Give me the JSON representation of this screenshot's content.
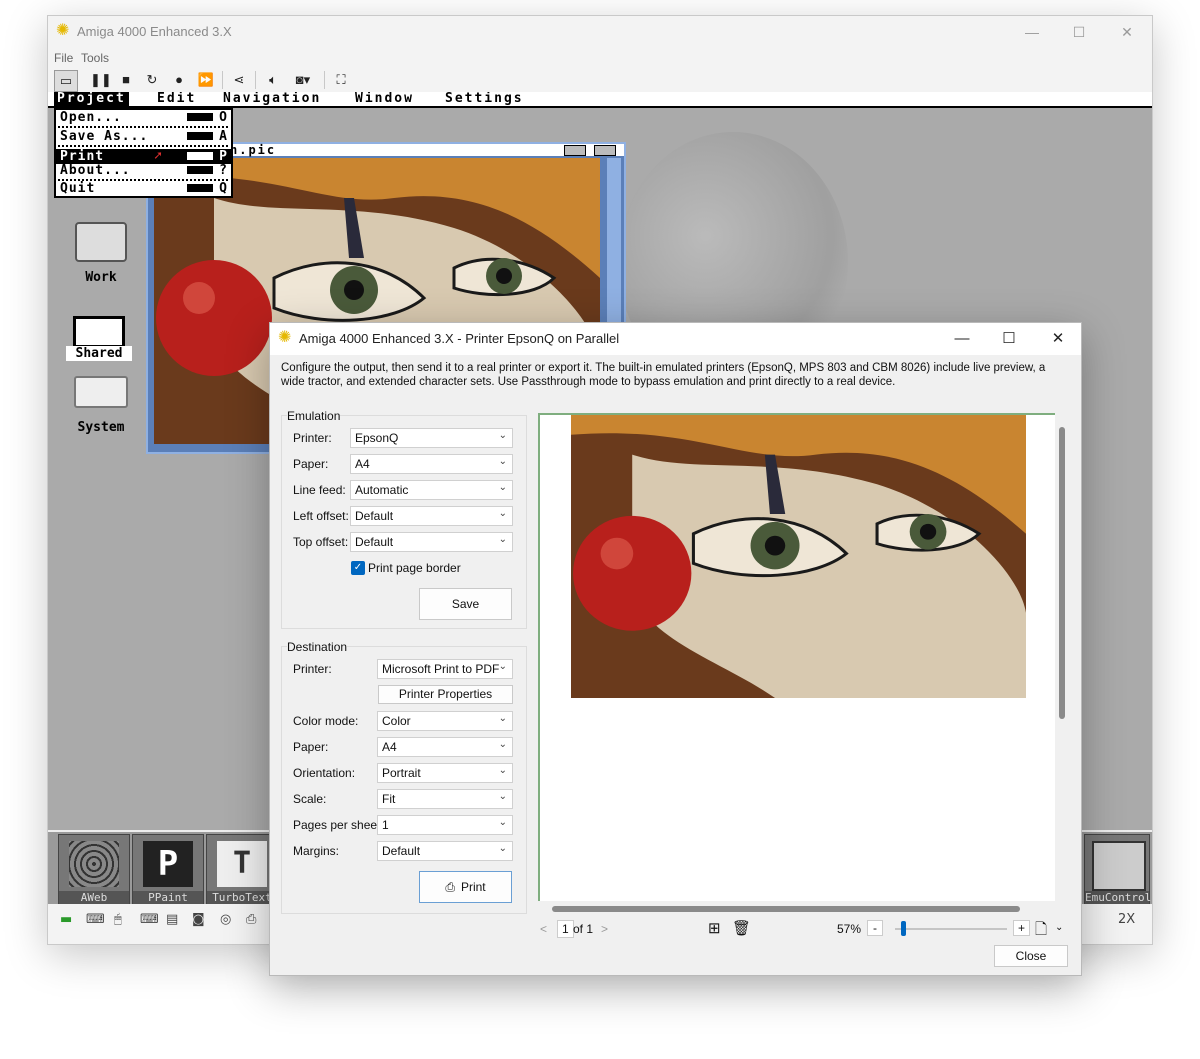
{
  "main_window": {
    "title": "Amiga 4000 Enhanced 3.X",
    "menu": [
      "File",
      "Tools"
    ],
    "toolbar": [
      {
        "icon": "screen-icon"
      },
      {
        "icon": "pause-icon"
      },
      {
        "icon": "stop-icon"
      },
      {
        "icon": "reset-icon"
      },
      {
        "icon": "record-icon"
      },
      {
        "icon": "fast-forward-icon"
      },
      {
        "icon": "share-icon"
      },
      {
        "icon": "volume-icon"
      },
      {
        "icon": "camera-icon"
      },
      {
        "icon": "fullscreen-icon"
      }
    ]
  },
  "amiga": {
    "menubar": [
      "Project",
      "Edit",
      "Navigation",
      "Window",
      "Settings"
    ],
    "project_menu": [
      {
        "label": "Open...",
        "key": "O"
      },
      {
        "label": "Save As...",
        "key": "A"
      },
      {
        "label": "Print",
        "key": "P",
        "selected": true
      },
      {
        "label": "About...",
        "key": "?"
      },
      {
        "label": "Quit",
        "key": "Q"
      }
    ],
    "picture_window_title": "n.pic",
    "icons": [
      "Work",
      "Shared",
      "System"
    ],
    "dock": {
      "left": [
        "AWeb",
        "PPaint",
        "TurboText"
      ],
      "right": "EmuControl"
    },
    "status_zoom": "2X"
  },
  "dialog": {
    "title": "Amiga 4000 Enhanced 3.X - Printer EpsonQ on Parallel",
    "description": "Configure the output, then send it to a real printer or export it. The built-in emulated printers (EpsonQ, MPS 803 and CBM 8026) include live preview, a wide tractor, and extended character sets. Use Passthrough mode to bypass emulation and print directly to a real device.",
    "emulation": {
      "title": "Emulation",
      "printer": {
        "label": "Printer:",
        "value": "EpsonQ"
      },
      "paper": {
        "label": "Paper:",
        "value": "A4"
      },
      "line_feed": {
        "label": "Line feed:",
        "value": "Automatic"
      },
      "left_offset": {
        "label": "Left offset:",
        "value": "Default"
      },
      "top_offset": {
        "label": "Top offset:",
        "value": "Default"
      },
      "print_page_border": {
        "label": "Print page border",
        "checked": true
      },
      "save_label": "Save"
    },
    "destination": {
      "title": "Destination",
      "printer": {
        "label": "Printer:",
        "value": "Microsoft Print to PDF"
      },
      "properties_label": "Printer Properties",
      "color_mode": {
        "label": "Color mode:",
        "value": "Color"
      },
      "paper": {
        "label": "Paper:",
        "value": "A4"
      },
      "orientation": {
        "label": "Orientation:",
        "value": "Portrait"
      },
      "scale": {
        "label": "Scale:",
        "value": "Fit"
      },
      "pages_per_sheet": {
        "label": "Pages per sheet:",
        "value": "1"
      },
      "margins": {
        "label": "Margins:",
        "value": "Default"
      },
      "print_label": "Print"
    },
    "preview": {
      "page": "1",
      "of_pages": "of 1",
      "zoom": "57%",
      "zoom_level": 0.05
    },
    "close_label": "Close"
  }
}
